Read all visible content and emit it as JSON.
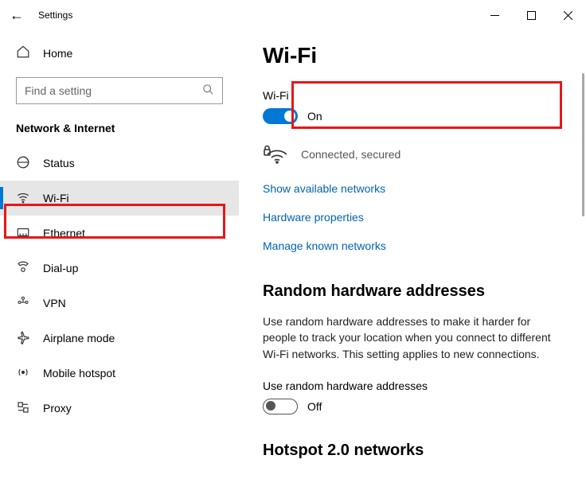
{
  "titlebar": {
    "title": "Settings"
  },
  "sidebar": {
    "home": "Home",
    "search_placeholder": "Find a setting",
    "section": "Network & Internet",
    "items": [
      {
        "label": "Status",
        "icon": "status-icon"
      },
      {
        "label": "Wi-Fi",
        "icon": "wifi-icon"
      },
      {
        "label": "Ethernet",
        "icon": "ethernet-icon"
      },
      {
        "label": "Dial-up",
        "icon": "dialup-icon"
      },
      {
        "label": "VPN",
        "icon": "vpn-icon"
      },
      {
        "label": "Airplane mode",
        "icon": "airplane-icon"
      },
      {
        "label": "Mobile hotspot",
        "icon": "hotspot-icon"
      },
      {
        "label": "Proxy",
        "icon": "proxy-icon"
      }
    ]
  },
  "content": {
    "title": "Wi-Fi",
    "wifi_label": "Wi-Fi",
    "wifi_state": "On",
    "connection_status": "Connected, secured",
    "links": {
      "show_networks": "Show available networks",
      "hw_props": "Hardware properties",
      "manage_known": "Manage known networks"
    },
    "random_hw": {
      "heading": "Random hardware addresses",
      "body": "Use random hardware addresses to make it harder for people to track your location when you connect to different Wi-Fi networks. This setting applies to new connections.",
      "toggle_label": "Use random hardware addresses",
      "toggle_state": "Off"
    },
    "hotspot_heading": "Hotspot 2.0 networks"
  }
}
